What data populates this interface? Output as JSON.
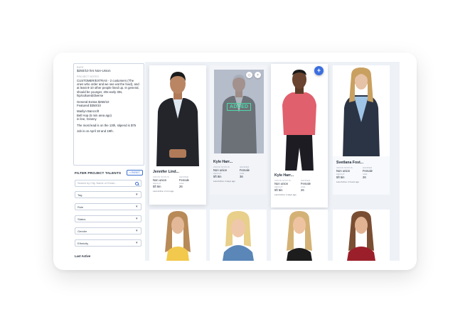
{
  "notes": {
    "rate_label": "Rate",
    "rate_value": "$250/10 hrs Non-Union",
    "project_notes_label": "Project notes",
    "paragraphs": [
      "CUSTOMER/EXTRAS - 2 customers (The ones who order and we see eat the food), and at least 8-10 other people lined up. In general, should be younger, 20s-early 30s, hip/cultured/diverse",
      "General Extras $250/10\nFeatured $350/10",
      "Marilyn Bancroft\nBell Hop (6 min area ago)\nin line, Granny",
      "The most lead is on the 13th, stipend is $75",
      "Job is on April 18 and 19th."
    ]
  },
  "filter": {
    "title": "FILTER PROJECT TALENTS",
    "reset": "× RESET",
    "search_placeholder": "Search by City, Name or Email...",
    "selects": [
      "Tag",
      "Role",
      "Status",
      "Gender",
      "Ethnicity"
    ],
    "last_active": "Last Active"
  },
  "cards": [
    {
      "name": "Jennifer Lind...",
      "union_label": "Union status",
      "union": "Non union",
      "gender_label": "Gender",
      "gender": "Female",
      "height_label": "Height",
      "height": "5ft 6in",
      "age_label": "Age",
      "age": "26",
      "updated": "Last Active: 2 min ago"
    },
    {
      "name": "Kyle Harr...",
      "union_label": "Union status",
      "union": "Non union",
      "gender_label": "Gender",
      "gender": "Female",
      "height_label": "Height",
      "height": "5ft 8in",
      "age_label": "Age",
      "age": "36",
      "updated": "Last Active: 2 days ago",
      "added": "ADDED"
    },
    {
      "name": "Kyle Harr...",
      "union_label": "Union status",
      "union": "Non union",
      "gender_label": "Gender",
      "gender": "Female",
      "height_label": "Height",
      "height": "5ft 6in",
      "age_label": "Age",
      "age": "26",
      "updated": "Last Active: 2 days ago"
    },
    {
      "name": "Svetlana Fost...",
      "union_label": "Union status",
      "union": "Non union",
      "gender_label": "Gender",
      "gender": "Female",
      "height_label": "Height",
      "height": "5ft 6in",
      "age_label": "Age",
      "age": "26",
      "updated": "Last Active: 2 hours ago"
    }
  ],
  "colors": {
    "accent": "#3b6fe0",
    "added_green": "#4cd9a6",
    "app_bg": "#eef2f7"
  },
  "icons": {
    "plus": "+",
    "tag": "◇",
    "close": "×"
  }
}
